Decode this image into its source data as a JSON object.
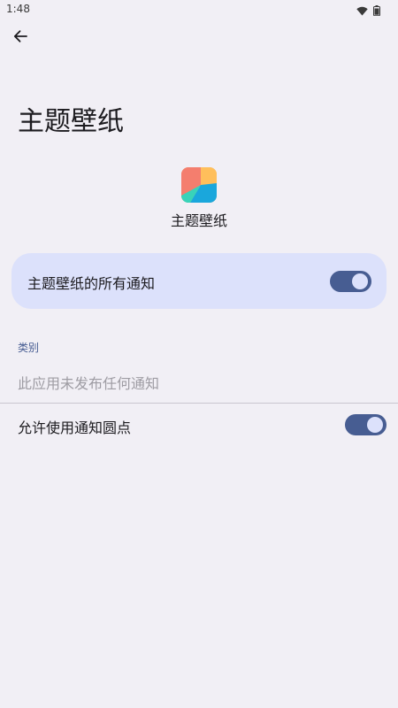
{
  "status_bar": {
    "time": "1:48",
    "icons": [
      "wifi-icon",
      "battery-icon"
    ]
  },
  "header": {
    "back_icon": "arrow-left-icon",
    "title": "主题壁纸"
  },
  "app": {
    "name": "主题壁纸",
    "icon": "app-icon"
  },
  "all_notifications": {
    "label": "主题壁纸的所有通知",
    "enabled": true
  },
  "categories": {
    "header": "类别",
    "empty_text": "此应用未发布任何通知"
  },
  "notification_dot": {
    "label": "允许使用通知圆点",
    "enabled": true
  },
  "colors": {
    "background": "#f1eff5",
    "card": "#dce1fb",
    "accent": "#475d92"
  }
}
